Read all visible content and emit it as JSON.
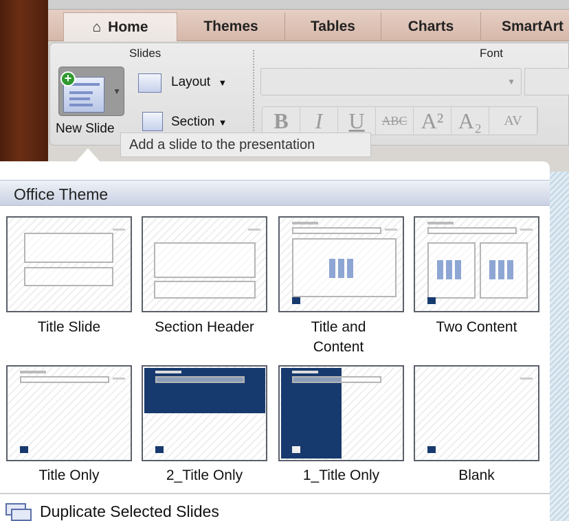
{
  "tabs": [
    {
      "label": "Home",
      "icon": "home-icon",
      "active": true
    },
    {
      "label": "Themes"
    },
    {
      "label": "Tables"
    },
    {
      "label": "Charts"
    },
    {
      "label": "SmartArt"
    }
  ],
  "ribbon": {
    "slides_group": "Slides",
    "font_group": "Font",
    "new_slide": "New Slide",
    "layout": "Layout",
    "section": "Section",
    "format_buttons": [
      "B",
      "I",
      "U",
      "ABC",
      "A²",
      "A₂",
      "AV"
    ]
  },
  "tooltip": "Add a slide to the presentation",
  "gallery": {
    "header": "Office Theme",
    "layouts": [
      {
        "label": "Title Slide",
        "type": "title-slide"
      },
      {
        "label": "Section Header",
        "type": "section-header"
      },
      {
        "label": "Title and Content",
        "type": "title-content"
      },
      {
        "label": "Two Content",
        "type": "two-content"
      },
      {
        "label": "Title Only",
        "type": "title-only"
      },
      {
        "label": "2_Title Only",
        "type": "title-only-navy-top"
      },
      {
        "label": "1_Title Only",
        "type": "title-only-navy-left"
      },
      {
        "label": "Blank",
        "type": "blank"
      }
    ],
    "duplicate": "Duplicate Selected Slides"
  },
  "colors": {
    "navy": "#173a6e",
    "accent_green": "#2e9a2e"
  }
}
